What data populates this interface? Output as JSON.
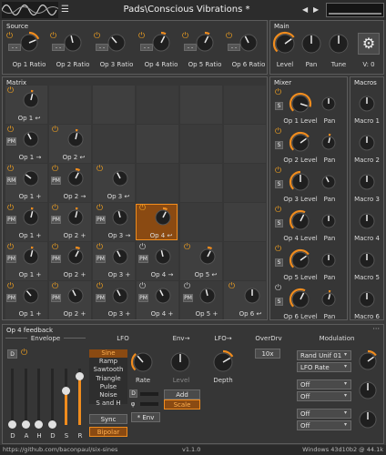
{
  "header": {
    "patch_name": "Pads\\Conscious Vibrations *",
    "prev_label": "◀",
    "next_label": "▶"
  },
  "source": {
    "title": "Source",
    "ratio_labels": [
      "Op 1 Ratio",
      "Op 2 Ratio",
      "Op 3 Ratio",
      "Op 4 Ratio",
      "Op 5 Ratio",
      "Op 6 Ratio"
    ],
    "small_btn": "- -"
  },
  "main": {
    "title": "Main",
    "labels": [
      "Level",
      "Pan",
      "Tune"
    ],
    "voices": "V: 0"
  },
  "matrix": {
    "title": "Matrix",
    "rows": [
      {
        "self": "Op 1 ↩",
        "cross": []
      },
      {
        "self": "Op 2 ↩",
        "cross": [
          "Op 1 →"
        ]
      },
      {
        "self": "Op 3 ↩",
        "cross": [
          "Op 1 +",
          "Op 2 →"
        ]
      },
      {
        "self": "Op 4 ↩",
        "cross": [
          "Op 1 +",
          "Op 2 +",
          "Op 3 →"
        ]
      },
      {
        "self": "Op 5 ↩",
        "cross": [
          "Op 1 +",
          "Op 2 +",
          "Op 3 +",
          "Op 4 →"
        ]
      },
      {
        "self": "Op 6 ↩",
        "cross": [
          "Op 1 +",
          "Op 2 +",
          "Op 3 +",
          "Op 4 +",
          "Op 5 +"
        ]
      }
    ],
    "btn_pm": "PM",
    "btn_rm": "RM"
  },
  "mixer": {
    "title": "Mixer",
    "level_labels": [
      "Op 1 Level",
      "Op 2 Level",
      "Op 3 Level",
      "Op 4 Level",
      "Op 5 Level",
      "Op 6 Level"
    ],
    "pan_label": "Pan",
    "solo": "S"
  },
  "macros": {
    "title": "Macros",
    "labels": [
      "Macro 1",
      "Macro 2",
      "Macro 3",
      "Macro 4",
      "Macro 5",
      "Macro 6"
    ]
  },
  "feedback": {
    "title": "Op 4 feedback",
    "menu": "···",
    "envelope": {
      "title": "Envelope",
      "d_btn": "D",
      "sliders": [
        "D",
        "A",
        "H",
        "D",
        "S",
        "R"
      ],
      "levels": [
        0.0,
        0.0,
        0.0,
        0.0,
        0.6,
        0.85
      ]
    },
    "lfo": {
      "title": "LFO",
      "shapes": [
        "Sine",
        "Ramp",
        "Sawtooth",
        "Triangle",
        "Pulse",
        "Noise",
        "S and H"
      ],
      "selected": "Sine",
      "sync": "Sync",
      "bipolar": "Bipolar",
      "rate": "Rate",
      "tempo_btn": "D",
      "phase_btn": "φ"
    },
    "env_arrow": {
      "title": "Env→",
      "level": "Level",
      "add": "Add",
      "scale": "Scale",
      "env_btn": "* Env"
    },
    "lfo_arrow": {
      "title": "LFO→",
      "depth": "Depth"
    },
    "overdrv": {
      "title": "OverDrv",
      "value": "10x"
    },
    "modulation": {
      "title": "Modulation",
      "rows": [
        {
          "source": "Rand Unif 01",
          "target": "LFO Rate"
        },
        {
          "source": "Off",
          "target": "Off"
        },
        {
          "source": "Off",
          "target": "Off"
        }
      ]
    }
  },
  "footer": {
    "url": "https://github.com/baconpaul/six-sines",
    "version": "v1.1.0",
    "build": "Windows 43d10b2 @ 44.1k"
  },
  "colors": {
    "accent": "#f08c1e",
    "background": "#3a3a3a"
  }
}
